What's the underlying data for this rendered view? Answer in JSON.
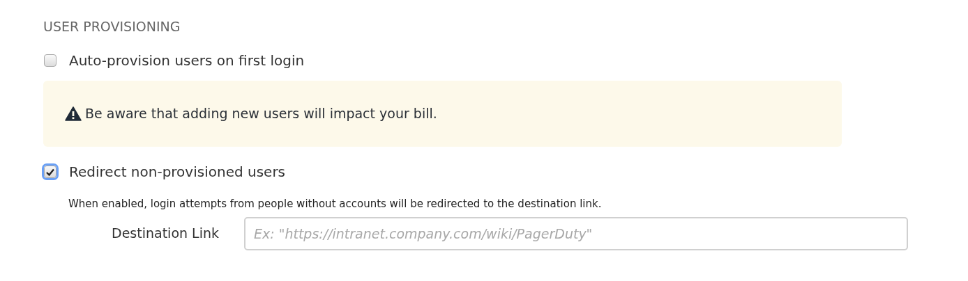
{
  "section_title": "USER PROVISIONING",
  "options": [
    {
      "label": "Auto-provision users on first login",
      "checked": false,
      "focused": false
    },
    {
      "label": "Redirect non-provisioned users",
      "checked": true,
      "focused": true
    }
  ],
  "warning": {
    "text": "Be aware that adding new users will impact your bill."
  },
  "redirect_help": "When enabled, login attempts from people without accounts will be redirected to the destination link.",
  "destination_field": {
    "label": "Destination Link",
    "placeholder": "Ex: \"https://intranet.company.com/wiki/PagerDuty\""
  }
}
